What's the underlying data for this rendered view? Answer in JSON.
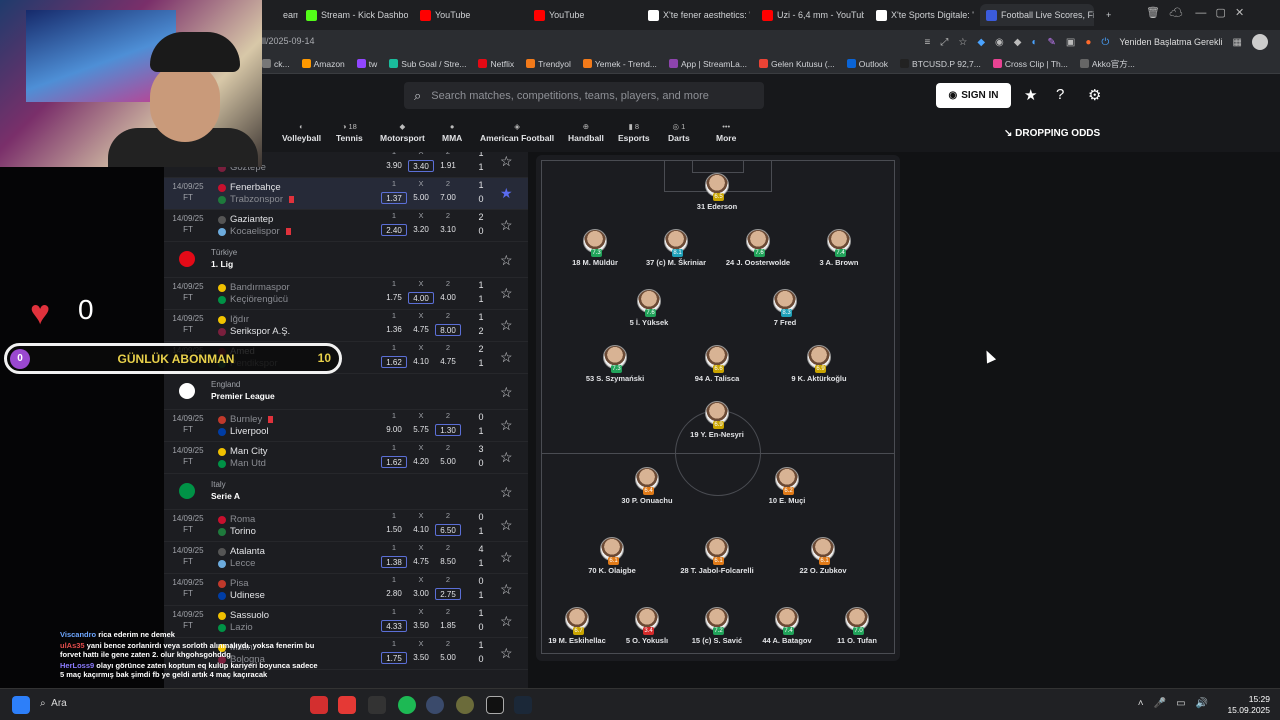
{
  "browser": {
    "tabs": [
      {
        "label": "eaming",
        "color": "#1e1f22"
      },
      {
        "label": "Stream - Kick Dashboard",
        "color": "#53fc18"
      },
      {
        "label": "YouTube",
        "color": "#ff0000"
      },
      {
        "label": "YouTube",
        "color": "#ff0000"
      },
      {
        "label": "X'te fener aesthetics: \"htt",
        "color": "#ffffff"
      },
      {
        "label": "Uzi - 6,4 mm - YouTube",
        "color": "#ff0000"
      },
      {
        "label": "X'te Sports Digitale: \" ðŸ”¥",
        "color": "#ffffff"
      },
      {
        "label": "Football Live Scores, Fixt",
        "color": "#3b5bdb"
      }
    ],
    "url": "ll/2025-09-14",
    "restart_label": "Yeniden Başlatma Gerekli",
    "bookmarks": [
      {
        "label": "ck...",
        "color": "#777"
      },
      {
        "label": "Amazon",
        "color": "#ff9900"
      },
      {
        "label": "tw",
        "color": "#9146ff"
      },
      {
        "label": "Sub Goal / Stre...",
        "color": "#1abc9c"
      },
      {
        "label": "Netflix",
        "color": "#e50914"
      },
      {
        "label": "Trendyol",
        "color": "#f27a1a"
      },
      {
        "label": "Yemek - Trend...",
        "color": "#f27a1a"
      },
      {
        "label": "App | StreamLa...",
        "color": "#8e44ad"
      },
      {
        "label": "Gelen Kutusu (...",
        "color": "#ea4335"
      },
      {
        "label": "Outlook",
        "color": "#0a64d6"
      },
      {
        "label": "BTCUSD.P 92,7...",
        "color": "#222"
      },
      {
        "label": "Cross Clip | Th...",
        "color": "#e84393"
      },
      {
        "label": "Akko官方...",
        "color": "#666"
      }
    ]
  },
  "site": {
    "search_placeholder": "Search matches, competitions, teams, players, and more",
    "signin_label": "SIGN IN",
    "dropping_odds": "DROPPING ODDS",
    "sports": [
      {
        "label": "Volleyball",
        "count": ""
      },
      {
        "label": "Tennis",
        "count": "18"
      },
      {
        "label": "Motorsport",
        "count": ""
      },
      {
        "label": "MMA",
        "count": ""
      },
      {
        "label": "American Football",
        "count": ""
      },
      {
        "label": "Handball",
        "count": ""
      },
      {
        "label": "Esports",
        "count": "8"
      },
      {
        "label": "Darts",
        "count": "1"
      },
      {
        "label": "More",
        "count": ""
      }
    ]
  },
  "odds_headers": [
    "1",
    "X",
    "2"
  ],
  "matches": [
    {
      "date": "",
      "status": "",
      "home": "...spor",
      "away": "Göztepe",
      "home_dim": true,
      "away_dim": true,
      "odds": [
        "3.90",
        "3.40",
        "1.91"
      ],
      "boxed": 1,
      "hs": "1",
      "as": "1",
      "fav": false
    },
    {
      "date": "14/09/25",
      "status": "FT",
      "home": "Fenerbahçe",
      "away": "Trabzonspor",
      "odds": [
        "1.37",
        "5.00",
        "7.00"
      ],
      "boxed": 0,
      "hs": "1",
      "as": "0",
      "fav": true,
      "away_red": true,
      "highlight": true,
      "away_dim": true
    },
    {
      "date": "14/09/25",
      "status": "FT",
      "home": "Gaziantep",
      "away": "Kocaelispor",
      "odds": [
        "2.40",
        "3.20",
        "3.10"
      ],
      "boxed": 0,
      "hs": "2",
      "as": "0",
      "fav": false,
      "away_red": true,
      "away_dim": true
    },
    {
      "league": true,
      "country": "Türkiye",
      "name": "1. Lig",
      "flag": "#e30a17"
    },
    {
      "date": "14/09/25",
      "status": "FT",
      "home": "Bandırmaspor",
      "away": "Keçiörengücü",
      "odds": [
        "1.75",
        "4.00",
        "4.00"
      ],
      "boxed": 1,
      "hs": "1",
      "as": "1",
      "fav": false,
      "home_dim": true,
      "away_dim": true
    },
    {
      "date": "14/09/25",
      "status": "FT",
      "home": "Iğdır",
      "away": "Serikspor A.Ş.",
      "odds": [
        "1.36",
        "4.75",
        "8.00"
      ],
      "boxed": 2,
      "hs": "1",
      "as": "2",
      "fav": false,
      "home_dim": true
    },
    {
      "date": "14/09/25",
      "status": "FT",
      "home": "Amed",
      "away": "Pendikspor",
      "odds": [
        "1.62",
        "4.10",
        "4.75"
      ],
      "boxed": 0,
      "hs": "2",
      "as": "1",
      "fav": false,
      "away_dim": true
    },
    {
      "league": true,
      "country": "England",
      "name": "Premier League",
      "flag": "#ffffff"
    },
    {
      "date": "14/09/25",
      "status": "FT",
      "home": "Burnley",
      "away": "Liverpool",
      "odds": [
        "9.00",
        "5.75",
        "1.30"
      ],
      "boxed": 2,
      "hs": "0",
      "as": "1",
      "fav": false,
      "home_red": true,
      "home_dim": true
    },
    {
      "date": "14/09/25",
      "status": "FT",
      "home": "Man City",
      "away": "Man Utd",
      "odds": [
        "1.62",
        "4.20",
        "5.00"
      ],
      "boxed": 0,
      "hs": "3",
      "as": "0",
      "fav": false,
      "away_dim": true
    },
    {
      "league": true,
      "country": "Italy",
      "name": "Serie A",
      "flag": "#009246"
    },
    {
      "date": "14/09/25",
      "status": "FT",
      "home": "Roma",
      "away": "Torino",
      "odds": [
        "1.50",
        "4.10",
        "6.50"
      ],
      "boxed": 2,
      "hs": "0",
      "as": "1",
      "fav": false,
      "home_dim": true
    },
    {
      "date": "14/09/25",
      "status": "FT",
      "home": "Atalanta",
      "away": "Lecce",
      "odds": [
        "1.38",
        "4.75",
        "8.50"
      ],
      "boxed": 0,
      "hs": "4",
      "as": "1",
      "fav": false,
      "away_dim": true
    },
    {
      "date": "14/09/25",
      "status": "FT",
      "home": "Pisa",
      "away": "Udinese",
      "odds": [
        "2.80",
        "3.00",
        "2.75"
      ],
      "boxed": 2,
      "hs": "0",
      "as": "1",
      "fav": false,
      "home_dim": true
    },
    {
      "date": "14/09/25",
      "status": "FT",
      "home": "Sassuolo",
      "away": "Lazio",
      "odds": [
        "4.33",
        "3.50",
        "1.85"
      ],
      "boxed": 0,
      "hs": "1",
      "as": "0",
      "fav": false,
      "away_dim": true
    },
    {
      "date": "",
      "status": "",
      "home": "Milan",
      "away": "Bologna",
      "odds": [
        "1.75",
        "3.50",
        "5.00"
      ],
      "boxed": 0,
      "hs": "1",
      "as": "0",
      "fav": false,
      "home_dim": true,
      "away_dim": true
    }
  ],
  "lineup": [
    {
      "name": "31 Ederson",
      "rating": "6.5",
      "rc": "#c9a400"
    },
    {
      "name": "18 M. Müldür",
      "rating": "7.3",
      "rc": "#21a35a"
    },
    {
      "name": "37 (c) M. Škriniar",
      "rating": "8.1",
      "rc": "#1fa0b8"
    },
    {
      "name": "24 J. Oosterwolde",
      "rating": "7.6",
      "rc": "#21a35a"
    },
    {
      "name": "3 A. Brown",
      "rating": "7.4",
      "rc": "#21a35a"
    },
    {
      "name": "5 İ. Yüksek",
      "rating": "7.6",
      "rc": "#21a35a"
    },
    {
      "name": "7 Fred",
      "rating": "8.3",
      "rc": "#1fa0b8"
    },
    {
      "name": "53 S. Szymański",
      "rating": "7.3",
      "rc": "#21a35a"
    },
    {
      "name": "94 A. Talisca",
      "rating": "6.6",
      "rc": "#c9a400"
    },
    {
      "name": "9 K. Aktürkoğlu",
      "rating": "6.9",
      "rc": "#c9a400"
    },
    {
      "name": "19 Y. En-Nesyri",
      "rating": "6.9",
      "rc": "#c9a400"
    },
    {
      "name": "30 P. Onuachu",
      "rating": "6.4",
      "rc": "#e07a18"
    },
    {
      "name": "10 E. Muçi",
      "rating": "6.2",
      "rc": "#e07a18"
    },
    {
      "name": "70 K. Olaigbe",
      "rating": "6.1",
      "rc": "#e07a18"
    },
    {
      "name": "28 T. Jabol-Folcarelli",
      "rating": "6.1",
      "rc": "#e07a18"
    },
    {
      "name": "22 O. Zubkov",
      "rating": "6.1",
      "rc": "#e07a18"
    },
    {
      "name": "19 M. Eskihellac",
      "rating": "6.7",
      "rc": "#c9a400"
    },
    {
      "name": "5 O. Yokuslı",
      "rating": "3.4",
      "rc": "#d42a2a"
    },
    {
      "name": "15 (c) S. Savić",
      "rating": "7.2",
      "rc": "#21a35a"
    },
    {
      "name": "44 A. Batagov",
      "rating": "7.4",
      "rc": "#21a35a"
    },
    {
      "name": "11 O. Tufan",
      "rating": "7.0",
      "rc": "#21a35a"
    }
  ],
  "stream": {
    "heart_count": "0",
    "sub_left": "0",
    "sub_label": "GÜNLÜK ABONMAN",
    "sub_goal": "10",
    "chat": [
      {
        "user": "Viscandro",
        "msg": "rica ederim ne demek",
        "cls": "user1"
      },
      {
        "user": "ulAs35",
        "msg": "yani bence zorlanirdı veya sorloth alınmalıydı. yoksa fenerim bu forvet hattı ile gene zaten 2. olur khgohsgohddg",
        "cls": "user2"
      },
      {
        "user": "HerLoss9",
        "msg": "olayı görünce zaten koptum eq kulüp kariyeri boyunca sadece 5 maç kaçırmış bak şimdi fb ye geldi artık 4 maç kaçıracak",
        "cls": "user3"
      }
    ]
  },
  "taskbar": {
    "search_label": "Ara",
    "time": "15:29",
    "date": "15.09.2025"
  }
}
